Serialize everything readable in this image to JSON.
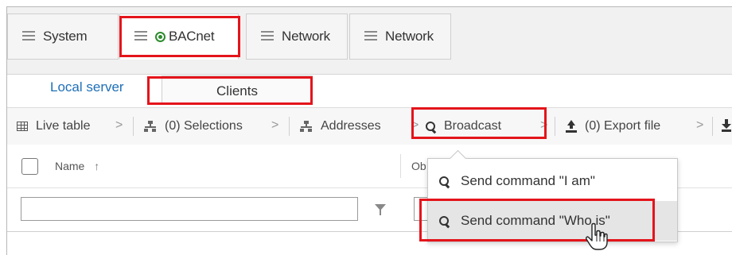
{
  "tabs": [
    {
      "label": "System",
      "icon": "menu-icon",
      "active": false
    },
    {
      "label": "BACnet",
      "icon": "menu-icon",
      "status": "online-status-icon",
      "status_color": "#2d8c2d",
      "active": true
    },
    {
      "label": "Network",
      "icon": "menu-icon",
      "active": false
    },
    {
      "label": "Network",
      "icon": "menu-icon",
      "active": false
    }
  ],
  "subtabs": [
    {
      "label": "Local server",
      "style": "link",
      "color": "#1e6fb8"
    },
    {
      "label": "Clients",
      "style": "selected"
    }
  ],
  "toolbar": {
    "live_table": "Live table",
    "selections": "(0) Selections",
    "addresses": "Addresses",
    "broadcast": "Broadcast",
    "export_file": "(0) Export file"
  },
  "table": {
    "col_name": "Name",
    "col_name_sort": "↑",
    "col_other": "Ob"
  },
  "broadcast_menu": {
    "items": [
      {
        "label": "Send command \"I am\""
      },
      {
        "label": "Send command \"Who is\"",
        "hovered": true
      }
    ]
  },
  "colors": {
    "highlight": "#e4141b",
    "accent_link": "#1e6fb8",
    "status_green": "#2d8c2d"
  }
}
